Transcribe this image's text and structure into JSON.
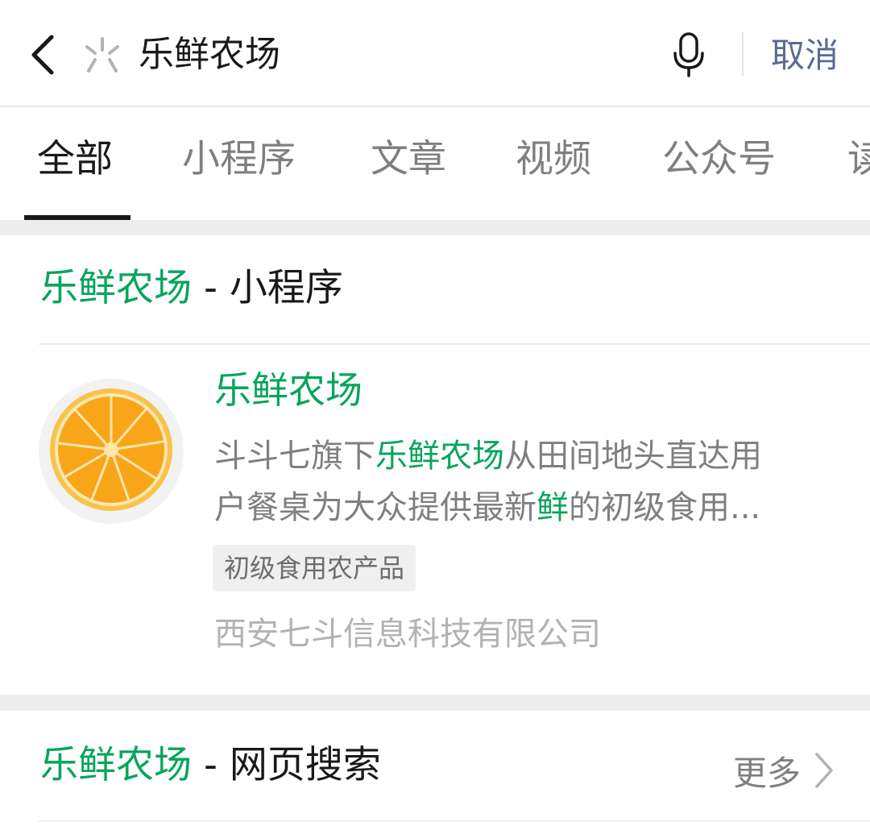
{
  "search": {
    "query": "乐鲜农场",
    "cancel_label": "取消"
  },
  "icons": {
    "back": "chevron-left-icon",
    "miniprogram": "miniprogram-icon",
    "mic": "microphone-icon",
    "more": "chevron-right-icon"
  },
  "tabs": [
    {
      "label": "全部",
      "active": true
    },
    {
      "label": "小程序"
    },
    {
      "label": "文章"
    },
    {
      "label": "视频"
    },
    {
      "label": "公众号"
    },
    {
      "label": "读"
    }
  ],
  "miniprogram_section": {
    "keyword": "乐鲜农场",
    "suffix": " - 小程序",
    "result": {
      "name": "乐鲜农场",
      "desc_line1_pre": "斗斗七旗下",
      "desc_line1_hl": "乐鲜农场",
      "desc_line1_post": "从田间地头直达用",
      "desc_line2_pre": "户餐桌为大众提供最新",
      "desc_line2_hl": "鲜",
      "desc_line2_post": "的初级食用...",
      "tag": "初级食用农产品",
      "company": "西安七斗信息科技有限公司"
    }
  },
  "web_section": {
    "keyword": "乐鲜农场",
    "suffix": " - 网页搜索",
    "more_label": "更多"
  },
  "colors": {
    "highlight": "#07a55b",
    "link": "#576b95",
    "text": "#191919",
    "secondary": "#7f7f7f",
    "background": "#ededed"
  }
}
